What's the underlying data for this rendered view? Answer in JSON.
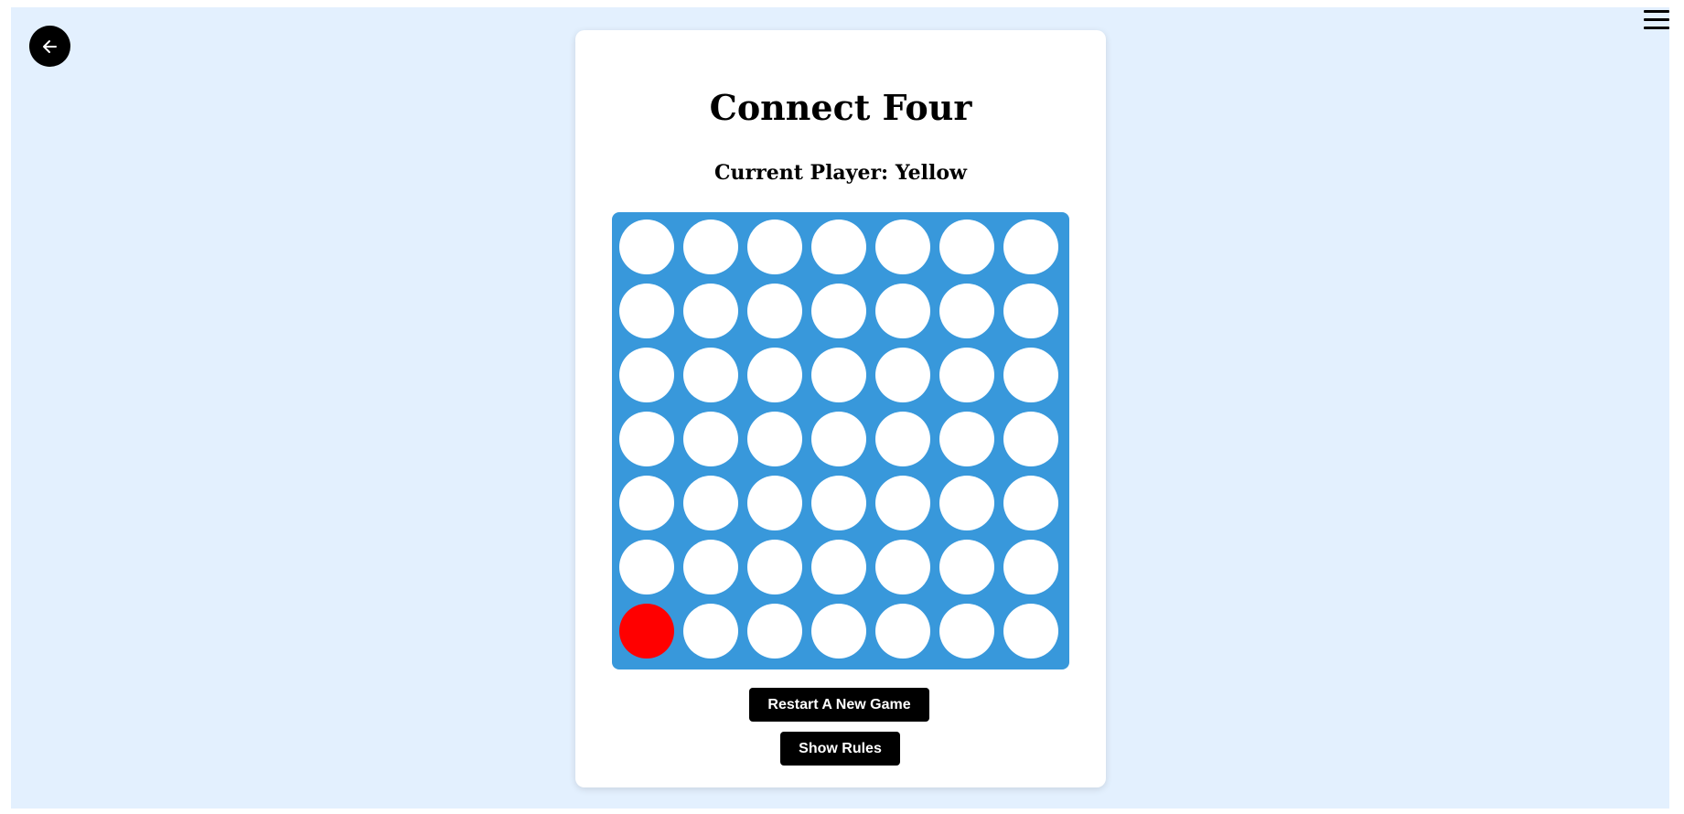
{
  "icons": {
    "back": "arrow-left-icon",
    "menu": "hamburger-menu-icon"
  },
  "game": {
    "title": "Connect Four",
    "current_player_text": "Current Player: Yellow",
    "rows": 7,
    "columns": 7,
    "board": [
      [
        "empty",
        "empty",
        "empty",
        "empty",
        "empty",
        "empty",
        "empty"
      ],
      [
        "empty",
        "empty",
        "empty",
        "empty",
        "empty",
        "empty",
        "empty"
      ],
      [
        "empty",
        "empty",
        "empty",
        "empty",
        "empty",
        "empty",
        "empty"
      ],
      [
        "empty",
        "empty",
        "empty",
        "empty",
        "empty",
        "empty",
        "empty"
      ],
      [
        "empty",
        "empty",
        "empty",
        "empty",
        "empty",
        "empty",
        "empty"
      ],
      [
        "empty",
        "empty",
        "empty",
        "empty",
        "empty",
        "empty",
        "empty"
      ],
      [
        "red",
        "empty",
        "empty",
        "empty",
        "empty",
        "empty",
        "empty"
      ]
    ]
  },
  "buttons": {
    "restart_label": "Restart A New Game",
    "rules_label": "Show Rules"
  },
  "colors": {
    "page_background": "#e3f0fe",
    "board": "#3898db",
    "empty_cell": "#ffffff",
    "red_piece": "#ff0000",
    "yellow_piece": "#ffd700",
    "button_background": "#000000",
    "button_text": "#ffffff"
  }
}
